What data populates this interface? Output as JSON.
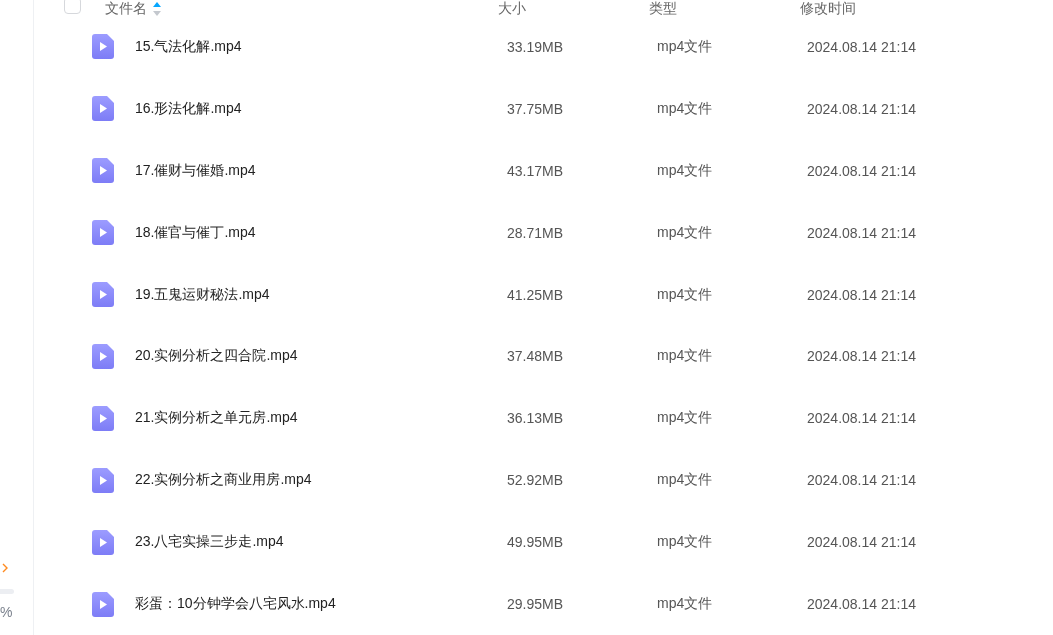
{
  "sidebar": {
    "percent_label": "%"
  },
  "table": {
    "select_all": {
      "checked": false
    },
    "columns": [
      {
        "label": "文件名",
        "sorted_ascending": true
      },
      {
        "label": "大小",
        "sorted_ascending": false
      },
      {
        "label": "类型",
        "sorted_ascending": false
      },
      {
        "label": "修改时间",
        "sorted_ascending": false
      }
    ],
    "rows": [
      {
        "name": "15.气法化解.mp4",
        "size": "33.19MB",
        "type": "mp4文件",
        "modified": "2024.08.14 21:14"
      },
      {
        "name": "16.形法化解.mp4",
        "size": "37.75MB",
        "type": "mp4文件",
        "modified": "2024.08.14 21:14"
      },
      {
        "name": "17.催财与催婚.mp4",
        "size": "43.17MB",
        "type": "mp4文件",
        "modified": "2024.08.14 21:14"
      },
      {
        "name": "18.催官与催丁.mp4",
        "size": "28.71MB",
        "type": "mp4文件",
        "modified": "2024.08.14 21:14"
      },
      {
        "name": "19.五鬼运财秘法.mp4",
        "size": "41.25MB",
        "type": "mp4文件",
        "modified": "2024.08.14 21:14"
      },
      {
        "name": "20.实例分析之四合院.mp4",
        "size": "37.48MB",
        "type": "mp4文件",
        "modified": "2024.08.14 21:14"
      },
      {
        "name": "21.实例分析之单元房.mp4",
        "size": "36.13MB",
        "type": "mp4文件",
        "modified": "2024.08.14 21:14"
      },
      {
        "name": "22.实例分析之商业用房.mp4",
        "size": "52.92MB",
        "type": "mp4文件",
        "modified": "2024.08.14 21:14"
      },
      {
        "name": "23.八宅实操三步走.mp4",
        "size": "49.95MB",
        "type": "mp4文件",
        "modified": "2024.08.14 21:14"
      },
      {
        "name": "彩蛋：10分钟学会八宅风水.mp4",
        "size": "29.95MB",
        "type": "mp4文件",
        "modified": "2024.08.14 21:14"
      }
    ]
  }
}
